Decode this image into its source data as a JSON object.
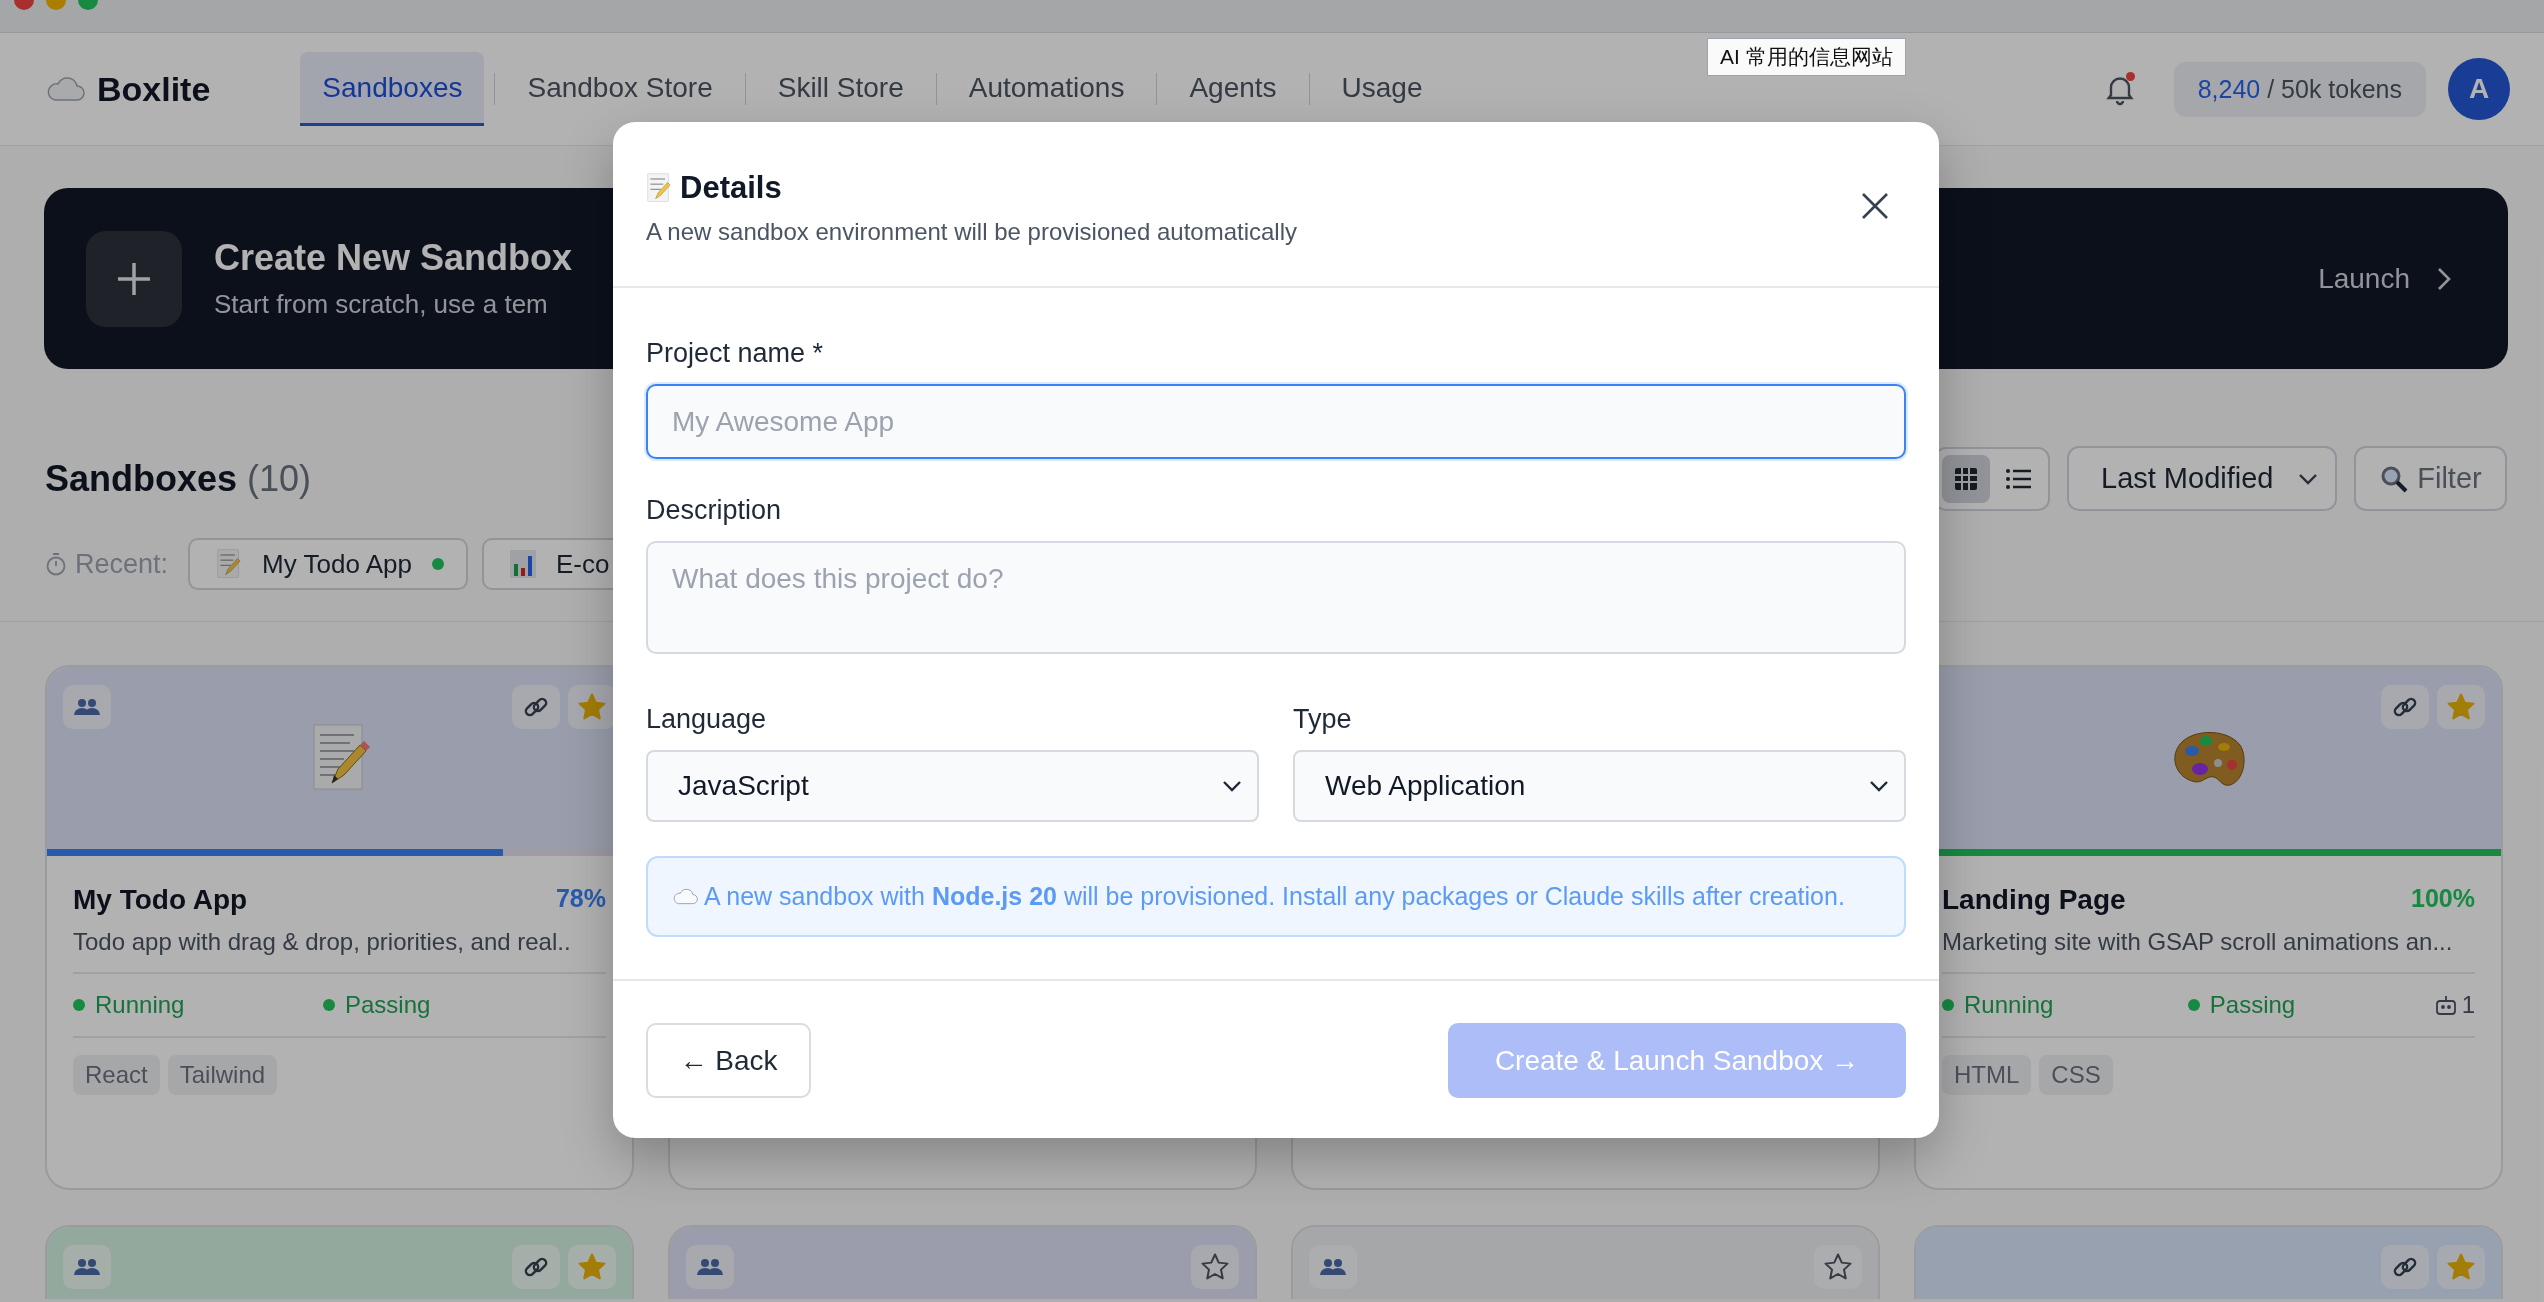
{
  "tooltip": "AI 常用的信息网站",
  "nav": {
    "logo": "Boxlite",
    "tabs": [
      {
        "label": "Sandboxes",
        "selected": true
      },
      {
        "label": "Sandbox Store",
        "selected": false
      },
      {
        "label": "Skill Store",
        "selected": false
      },
      {
        "label": "Automations",
        "selected": false
      },
      {
        "label": "Agents",
        "selected": false
      },
      {
        "label": "Usage",
        "selected": false
      }
    ],
    "has_notification": true,
    "tokens_used": "8,240",
    "tokens_limit": "/ 50k tokens",
    "avatar": "A"
  },
  "banner": {
    "title": "Create New Sandbox",
    "subtitle": "Start from scratch, use a tem",
    "action": "Launch"
  },
  "sandboxes": {
    "title": "Sandboxes",
    "count": "(10)",
    "view_modes": [
      {
        "kind": "grid",
        "selected": true
      },
      {
        "kind": "list",
        "selected": false
      }
    ],
    "sort": "Last Modified",
    "filter": "Filter",
    "recent_label": "Recent:",
    "recent": [
      {
        "name": "My Todo App",
        "running": true
      },
      {
        "name": "E-co"
      }
    ]
  },
  "cards": [
    {
      "kind": "full",
      "color": "#9b9fac",
      "shared": true,
      "linked": true,
      "starred": true,
      "title": "My Todo App",
      "progress": "78%",
      "level": 0.78,
      "description": "Todo app with drag & drop, priorities, and real..",
      "status": "Running",
      "tests": "Passing",
      "tags": [
        "React",
        "Tailwind"
      ]
    },
    {
      "kind": "covered"
    },
    {
      "kind": "covered"
    },
    {
      "kind": "full",
      "color": "#9b9fac",
      "linked": true,
      "starred": true,
      "title": "Landing Page",
      "progress": "100%",
      "level": 1,
      "description": "Marketing site with GSAP scroll animations an...",
      "status": "Running",
      "tests": "Passing",
      "agents": "1",
      "tags": [
        "HTML",
        "CSS"
      ]
    },
    {
      "kind": "partial",
      "color": "#95aa9e",
      "shared": true,
      "linked": true,
      "starred": true
    },
    {
      "kind": "partial",
      "color": "#9c9dac",
      "shared": true,
      "linked": false,
      "starred": false
    },
    {
      "kind": "partial",
      "color": "#a5a7a9",
      "shared": true,
      "linked": false,
      "starred": false
    },
    {
      "kind": "partial",
      "color": "#98a2b0",
      "shared": false,
      "linked": true,
      "starred": true
    }
  ],
  "modal": {
    "title": "Details",
    "subtitle": "A new sandbox environment will be provisioned automatically",
    "fields": [
      {
        "kind": "input",
        "label": "Project name *",
        "placeholder": "My Awesome App",
        "focused": true
      },
      {
        "kind": "textarea",
        "label": "Description",
        "placeholder": "What does this project do?",
        "focused": false
      }
    ],
    "selects": [
      {
        "label": "Language",
        "value": "JavaScript"
      },
      {
        "label": "Type",
        "value": "Web Application"
      }
    ],
    "info": "A new sandbox with **Node.js 20** will be provisioned. Install any packages or Claude skills after creation.",
    "back": "← Back",
    "submit": "Create & Launch Sandbox →",
    "submit_disabled": true
  }
}
